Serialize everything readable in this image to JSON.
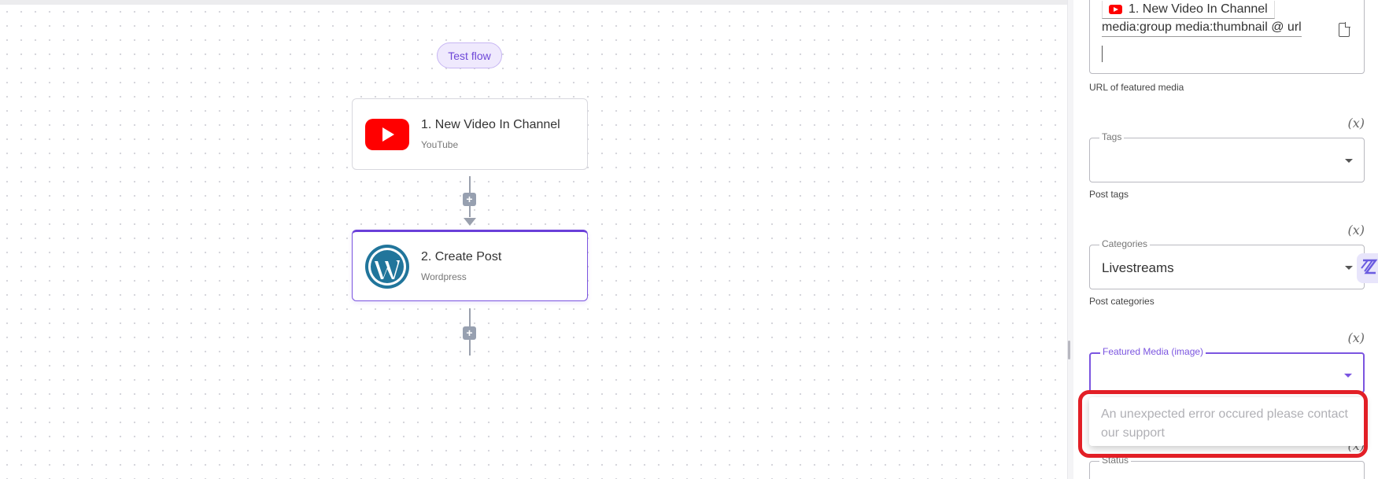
{
  "canvas": {
    "test_flow_label": "Test flow",
    "nodes": [
      {
        "title": "1. New Video In Channel",
        "app": "YouTube",
        "icon": "youtube-icon"
      },
      {
        "title": "2. Create Post",
        "app": "Wordpress",
        "icon": "wordpress-icon"
      }
    ],
    "add_step_icon": "+"
  },
  "panel": {
    "featured_media_url": {
      "chip_label": "1. New Video In Channel",
      "path_text": "media:group media:thumbnail @ url",
      "helper": "URL of featured media"
    },
    "variable_toggle_label": "(x)",
    "tags": {
      "legend": "Tags",
      "value": "",
      "helper": "Post tags"
    },
    "categories": {
      "legend": "Categories",
      "value": "Livestreams",
      "helper": "Post categories"
    },
    "featured_media": {
      "legend": "Featured Media (image)",
      "value": "",
      "dropdown_message": "An unexpected error occured please contact our support"
    },
    "status": {
      "legend": "Status"
    }
  },
  "colors": {
    "accent": "#6a3fd9",
    "highlight": "#e21f26",
    "youtube": "#ff0000",
    "wordpress": "#21759b"
  }
}
